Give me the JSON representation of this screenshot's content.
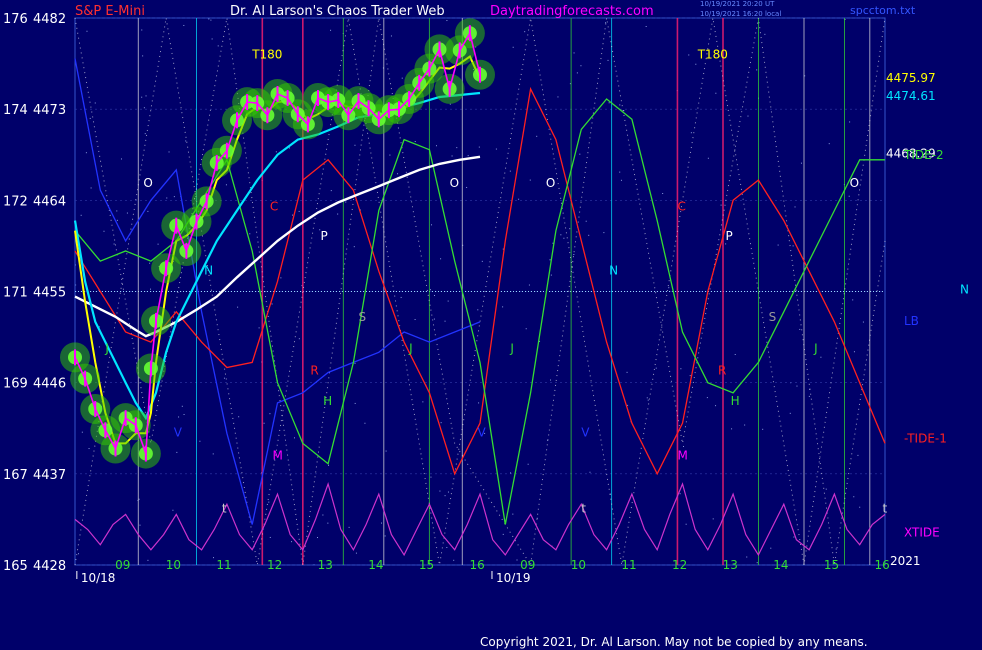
{
  "header": {
    "instrument": "S&P E-Mini",
    "site": "Dr. Al Larson's Chaos Trader Web",
    "url": "Daytradingforecasts.com",
    "file": "spcctom.txt",
    "stamp1": "10/19/2021 20:20 UT",
    "stamp2": "10/19/2021 16:20 local"
  },
  "copyright": "Copyright 2021, Dr. Al Larson. May not be copied by any means.",
  "colors": {
    "background": "#00006a",
    "price_bars": "#ff00ff",
    "glow": "#33cc00",
    "fast_ma": "#ffff00",
    "mid_ma": "#00e5ff",
    "slow_ma": "#ffffff",
    "lb_line": "#2233ff",
    "tide1": "#ff2020",
    "tide2": "#33dd33",
    "xtide": "#cc33cc"
  },
  "chart_data": {
    "type": "line",
    "title": "S&P E-Mini",
    "ylim": [
      4428,
      4482
    ],
    "xlim": [
      0,
      16
    ],
    "y_ticks": [
      {
        "left": "176",
        "right": "4482",
        "value": 4482
      },
      {
        "left": "174",
        "right": "4473",
        "value": 4473
      },
      {
        "left": "172",
        "right": "4464",
        "value": 4464
      },
      {
        "left": "171",
        "right": "4455",
        "value": 4455
      },
      {
        "left": "169",
        "right": "4446",
        "value": 4446
      },
      {
        "left": "167",
        "right": "4437",
        "value": 4437
      },
      {
        "left": "165",
        "right": "4428",
        "value": 4428
      }
    ],
    "hour_ticks": [
      {
        "label": "09",
        "x": 0.95
      },
      {
        "label": "10",
        "x": 1.95
      },
      {
        "label": "11",
        "x": 2.95
      },
      {
        "label": "12",
        "x": 3.95
      },
      {
        "label": "13",
        "x": 4.95
      },
      {
        "label": "14",
        "x": 5.95
      },
      {
        "label": "15",
        "x": 6.95
      },
      {
        "label": "16",
        "x": 7.95
      },
      {
        "label": "09",
        "x": 8.95
      },
      {
        "label": "10",
        "x": 9.95
      },
      {
        "label": "11",
        "x": 10.95
      },
      {
        "label": "12",
        "x": 11.95
      },
      {
        "label": "13",
        "x": 12.95
      },
      {
        "label": "14",
        "x": 13.95
      },
      {
        "label": "15",
        "x": 14.95
      },
      {
        "label": "16",
        "x": 15.95
      }
    ],
    "dates": [
      {
        "label": "10/18",
        "x": 0.55
      },
      {
        "label": "10/19",
        "x": 8.75
      }
    ],
    "year": "2021",
    "reference_level": 4455,
    "value_labels": [
      {
        "text": "4475.97",
        "y": 4476.1,
        "color": "#ffff00"
      },
      {
        "text": "4474.61",
        "y": 4474.3,
        "color": "#00e5ff"
      },
      {
        "text": "4468.29",
        "y": 4468.6,
        "color": "#ffffff"
      }
    ],
    "series": [
      {
        "name": "",
        "role": "price",
        "x": [
          0,
          0.2,
          0.4,
          0.6,
          0.8,
          1.0,
          1.2,
          1.4,
          1.5,
          1.6,
          1.8,
          2.0,
          2.2,
          2.4,
          2.6,
          2.8,
          3.0,
          3.2,
          3.4,
          3.6,
          3.8,
          4.0,
          4.2,
          4.4,
          4.6,
          4.8,
          5.0,
          5.2,
          5.4,
          5.6,
          5.8,
          6.0,
          6.2,
          6.4,
          6.6,
          6.8,
          7.0,
          7.2,
          7.4,
          7.6,
          7.8,
          8.0
        ],
        "y": [
          4448.5,
          4446.4,
          4443.4,
          4441.3,
          4439.5,
          4442.5,
          4441.8,
          4439.0,
          4447.4,
          4452.1,
          4457.3,
          4461.5,
          4459.0,
          4461.9,
          4463.9,
          4467.7,
          4468.9,
          4471.9,
          4473.7,
          4473.6,
          4472.4,
          4474.5,
          4474.1,
          4472.5,
          4471.5,
          4474.1,
          4473.7,
          4473.9,
          4472.4,
          4473.8,
          4473.1,
          4472.0,
          4472.9,
          4473.0,
          4474.0,
          4475.6,
          4477.0,
          4478.9,
          4475.0,
          4478.8,
          4480.5,
          4476.4
        ]
      },
      {
        "name": "",
        "role": "fast_ma",
        "x": [
          0,
          0.2,
          0.4,
          0.6,
          0.8,
          1.0,
          1.2,
          1.4,
          1.5,
          1.6,
          1.8,
          2.0,
          2.2,
          2.4,
          2.6,
          2.8,
          3.0,
          3.2,
          3.4,
          3.6,
          3.8,
          4.0,
          4.2,
          4.4,
          4.6,
          4.8,
          5.0,
          5.2,
          5.4,
          5.6,
          5.8,
          6.0,
          6.2,
          6.4,
          6.6,
          6.8,
          7.0,
          7.2,
          7.4,
          7.6,
          7.8,
          8.0
        ],
        "y": [
          4461,
          4454,
          4448,
          4443,
          4440,
          4440,
          4441,
          4441,
          4443,
          4448,
          4455,
          4460,
          4460.5,
          4461.5,
          4463,
          4466,
          4467,
          4470,
          4472.5,
          4473.2,
          4472.8,
          4473.7,
          4473.8,
          4473,
          4472,
          4472.5,
          4473.2,
          4473.6,
          4473.2,
          4473.3,
          4473.1,
          4472.5,
          4472.6,
          4472.8,
          4473.4,
          4474.5,
          4475.8,
          4477.1,
          4477,
          4477.5,
          4478.2,
          4476
        ]
      },
      {
        "name": "",
        "role": "mid_ma",
        "x": [
          0,
          0.2,
          0.4,
          0.6,
          0.8,
          1.0,
          1.2,
          1.4,
          1.6,
          1.8,
          2.0,
          2.4,
          2.8,
          3.2,
          3.6,
          4.0,
          4.4,
          4.8,
          5.2,
          5.6,
          6.0,
          6.4,
          6.8,
          7.2,
          7.6,
          8.0
        ],
        "y": [
          4462,
          4456,
          4452,
          4450,
          4448,
          4446,
          4444,
          4442.5,
          4445,
          4449,
          4452,
          4456,
          4460,
          4463,
          4466,
          4468.5,
          4470,
          4470.5,
          4471.3,
          4472.2,
          4472.5,
          4473.1,
          4473.6,
          4474.2,
          4474.4,
          4474.6
        ]
      },
      {
        "name": "",
        "role": "slow_ma",
        "x": [
          0,
          0.4,
          0.8,
          1.2,
          1.4,
          1.6,
          2.0,
          2.4,
          2.8,
          3.2,
          3.6,
          4.0,
          4.4,
          4.8,
          5.2,
          5.6,
          6.0,
          6.4,
          6.8,
          7.2,
          7.6,
          8.0
        ],
        "y": [
          4454.5,
          4453.5,
          4452.5,
          4451.2,
          4450.6,
          4451,
          4452,
          4453.2,
          4454.5,
          4456.4,
          4458.2,
          4460,
          4461.5,
          4462.8,
          4463.8,
          4464.6,
          4465.4,
          4466.2,
          4467,
          4467.6,
          4468,
          4468.3
        ]
      },
      {
        "name": "",
        "role": "tide1",
        "x": [
          0,
          0.5,
          1.0,
          1.5,
          2.0,
          2.5,
          3.0,
          3.5,
          4.0,
          4.5,
          5.0,
          5.5,
          6.0,
          6.5,
          7.0,
          7.5,
          8.0,
          8.5,
          9.0,
          9.5,
          10.0,
          10.5,
          11.0,
          11.5,
          12.0,
          12.5,
          13.0,
          13.5,
          14.0,
          14.5,
          15.0,
          15.5,
          16.0
        ],
        "y": [
          4459,
          4455,
          4451,
          4450,
          4453,
          4450,
          4447.5,
          4448,
          4456,
          4466,
          4468,
          4465,
          4457,
          4450,
          4445,
          4437,
          4442,
          4460,
          4475,
          4470,
          4460,
          4450,
          4442,
          4437,
          4442,
          4455,
          4464,
          4466,
          4462,
          4457,
          4452,
          4446,
          4440
        ]
      },
      {
        "name": "",
        "role": "tide2",
        "x": [
          0,
          0.5,
          1.0,
          1.5,
          2.0,
          2.5,
          3.0,
          3.5,
          4.0,
          4.5,
          5.0,
          5.5,
          6.0,
          6.5,
          7.0,
          7.5,
          8.0,
          8.5,
          9.0,
          9.5,
          10.0,
          10.5,
          11.0,
          11.5,
          12.0,
          12.5,
          13.0,
          13.5,
          14.0,
          14.5,
          15.0,
          15.5,
          16.0
        ],
        "y": [
          4461,
          4458,
          4459,
          4458,
          4460,
          4464,
          4468,
          4459,
          4446,
          4440,
          4438,
          4448,
          4463,
          4470,
          4469,
          4458,
          4448,
          4432,
          4445,
          4461,
          4471,
          4474,
          4472,
          4462,
          4451,
          4446,
          4445,
          4448,
          4453,
          4458,
          4463,
          4468,
          4468
        ]
      },
      {
        "name": "",
        "role": "lb",
        "x": [
          0,
          0.5,
          1.0,
          1.5,
          2.0,
          2.5,
          3.0,
          3.5,
          4.0,
          4.5,
          5.0,
          5.5,
          6.0,
          6.5,
          7.0,
          7.5,
          8.0
        ],
        "y": [
          4478,
          4465,
          4460,
          4464,
          4467,
          4453,
          4441,
          4432,
          4444,
          4445,
          4447,
          4448,
          4449,
          4451,
          4450,
          4451,
          4452
        ]
      },
      {
        "name": "",
        "role": "xtide",
        "x": [
          0,
          0.25,
          0.5,
          0.75,
          1.0,
          1.25,
          1.5,
          1.75,
          2.0,
          2.25,
          2.5,
          2.75,
          3.0,
          3.25,
          3.5,
          3.75,
          4.0,
          4.25,
          4.5,
          4.75,
          5.0,
          5.25,
          5.5,
          5.75,
          6.0,
          6.25,
          6.5,
          6.75,
          7.0,
          7.25,
          7.5,
          7.75,
          8.0,
          8.25,
          8.5,
          8.75,
          9.0,
          9.25,
          9.5,
          9.75,
          10.0,
          10.25,
          10.5,
          10.75,
          11.0,
          11.25,
          11.5,
          11.75,
          12.0,
          12.25,
          12.5,
          12.75,
          13.0,
          13.25,
          13.5,
          13.75,
          14.0,
          14.25,
          14.5,
          14.75,
          15.0,
          15.25,
          15.5,
          15.75,
          16.0
        ],
        "y": [
          4432.5,
          4431.5,
          4430,
          4432,
          4433,
          4431,
          4429.5,
          4431,
          4433,
          4430.5,
          4429.5,
          4431.5,
          4434,
          4431,
          4429.5,
          4432,
          4435,
          4431,
          4429.5,
          4432.5,
          4436,
          4431.5,
          4429.5,
          4432,
          4435,
          4431,
          4429,
          4431.5,
          4434,
          4431,
          4429.5,
          4432,
          4435,
          4430.5,
          4429,
          4431,
          4433,
          4430.5,
          4429.5,
          4432,
          4434,
          4431,
          4429.5,
          4432,
          4435,
          4431.5,
          4429.5,
          4433,
          4436,
          4431.5,
          4429.5,
          4432,
          4435,
          4431,
          4429,
          4431.5,
          4434,
          4430.5,
          4429.5,
          4432,
          4435,
          4431.5,
          4430,
          4432,
          4433
        ]
      },
      {
        "name": "",
        "role": "dotted_cycle_a",
        "x": [
          0,
          1.5,
          3.0,
          4.5,
          6.0,
          7.5,
          9.0,
          10.5,
          12.0,
          13.5,
          15.0,
          16.0
        ],
        "y": [
          4482,
          4440,
          4482,
          4428,
          4482,
          4440,
          4428,
          4482,
          4440,
          4482,
          4428,
          4460
        ]
      },
      {
        "name": "",
        "role": "dotted_cycle_b",
        "x": [
          0,
          1.8,
          3.6,
          5.4,
          7.2,
          9.0,
          10.8,
          12.6,
          14.4,
          16.0
        ],
        "y": [
          4428,
          4482,
          4428,
          4482,
          4428,
          4482,
          4428,
          4482,
          4428,
          4482
        ]
      }
    ],
    "vertical_lines": [
      {
        "x": 1.25,
        "color": "#dddddd"
      },
      {
        "x": 2.4,
        "color": "#00e5ff"
      },
      {
        "x": 3.7,
        "color": "#ff2070"
      },
      {
        "x": 4.5,
        "color": "#ff2070"
      },
      {
        "x": 5.3,
        "color": "#33dd33"
      },
      {
        "x": 6.1,
        "color": "#dddddd"
      },
      {
        "x": 7.0,
        "color": "#33dd33"
      },
      {
        "x": 7.65,
        "color": "#dddddd"
      },
      {
        "x": 9.8,
        "color": "#33dd33"
      },
      {
        "x": 10.6,
        "color": "#00e5ff"
      },
      {
        "x": 11.9,
        "color": "#ff2070"
      },
      {
        "x": 12.8,
        "color": "#ff2070"
      },
      {
        "x": 13.5,
        "color": "#33dd33"
      },
      {
        "x": 14.4,
        "color": "#dddddd"
      },
      {
        "x": 15.2,
        "color": "#33dd33"
      },
      {
        "x": 15.7,
        "color": "#dddddd"
      }
    ],
    "markers": [
      {
        "text": "T180",
        "x": 3.5,
        "y": 4478,
        "color": "#ffff00"
      },
      {
        "text": "T180",
        "x": 12.3,
        "y": 4478,
        "color": "#ffff00"
      },
      {
        "text": "O",
        "x": 1.35,
        "y": 4465.3,
        "color": "#ffffff"
      },
      {
        "text": "O",
        "x": 7.4,
        "y": 4465.3,
        "color": "#ffffff"
      },
      {
        "text": "O",
        "x": 9.3,
        "y": 4465.3,
        "color": "#ffffff"
      },
      {
        "text": "O",
        "x": 15.3,
        "y": 4465.3,
        "color": "#ffffff"
      },
      {
        "text": "C",
        "x": 3.85,
        "y": 4463,
        "color": "#ff2020"
      },
      {
        "text": "C",
        "x": 11.9,
        "y": 4463,
        "color": "#ff2020"
      },
      {
        "text": "P",
        "x": 4.85,
        "y": 4460.1,
        "color": "#ffffff"
      },
      {
        "text": "P",
        "x": 12.85,
        "y": 4460.1,
        "color": "#ffffff"
      },
      {
        "text": "N",
        "x": 2.55,
        "y": 4456.7,
        "color": "#00e5ff"
      },
      {
        "text": "N",
        "x": 10.55,
        "y": 4456.7,
        "color": "#00e5ff"
      },
      {
        "text": "S",
        "x": 5.6,
        "y": 4452.1,
        "color": "#999999"
      },
      {
        "text": "S",
        "x": 13.7,
        "y": 4452.1,
        "color": "#999999"
      },
      {
        "text": "J",
        "x": 0.6,
        "y": 4449,
        "color": "#33dd33"
      },
      {
        "text": "J",
        "x": 6.6,
        "y": 4449,
        "color": "#33dd33"
      },
      {
        "text": "J",
        "x": 8.6,
        "y": 4449,
        "color": "#33dd33"
      },
      {
        "text": "J",
        "x": 14.6,
        "y": 4449,
        "color": "#33dd33"
      },
      {
        "text": "R",
        "x": 4.65,
        "y": 4446.8,
        "color": "#ff2020"
      },
      {
        "text": "R",
        "x": 12.7,
        "y": 4446.8,
        "color": "#ff2020"
      },
      {
        "text": "H",
        "x": 4.9,
        "y": 4443.8,
        "color": "#33dd33"
      },
      {
        "text": "H",
        "x": 12.95,
        "y": 4443.8,
        "color": "#33dd33"
      },
      {
        "text": "V",
        "x": 1.95,
        "y": 4440.7,
        "color": "#2233ff"
      },
      {
        "text": "V",
        "x": 7.95,
        "y": 4440.7,
        "color": "#2233ff"
      },
      {
        "text": "V",
        "x": 10.0,
        "y": 4440.7,
        "color": "#2233ff"
      },
      {
        "text": "M",
        "x": 3.9,
        "y": 4438.4,
        "color": "#ff00ff"
      },
      {
        "text": "M",
        "x": 11.9,
        "y": 4438.4,
        "color": "#ff00ff"
      },
      {
        "text": "t",
        "x": 2.9,
        "y": 4433.2,
        "color": "#cccccc"
      },
      {
        "text": "t",
        "x": 10.0,
        "y": 4433.2,
        "color": "#cccccc"
      },
      {
        "text": "t",
        "x": 15.95,
        "y": 4433.2,
        "color": "#cccccc"
      }
    ],
    "right_labels": [
      {
        "text": "TIDE-2",
        "y": 4468.5,
        "color": "#33dd33"
      },
      {
        "text": "LB",
        "y": 4452.1,
        "color": "#2233ff"
      },
      {
        "text": "-TIDE-1",
        "y": 4440.5,
        "color": "#ff2020"
      },
      {
        "text": "XTIDE",
        "y": 4431.2,
        "color": "#ff00ff"
      },
      {
        "text": "N",
        "y": 4455.2,
        "color": "#00e5ff",
        "far": true
      }
    ]
  }
}
